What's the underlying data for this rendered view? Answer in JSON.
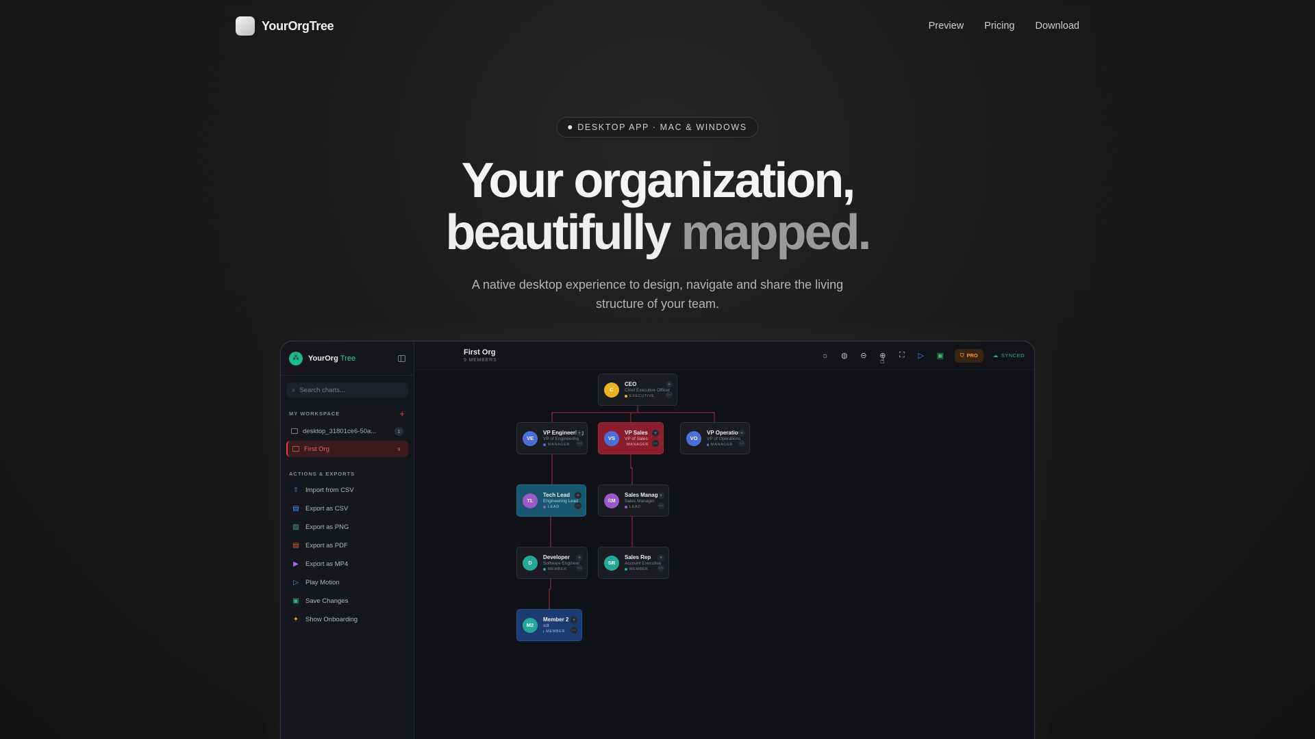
{
  "nav": {
    "brand": "YourOrgTree",
    "links": [
      "Preview",
      "Pricing",
      "Download"
    ]
  },
  "hero": {
    "pill": "DESKTOP APP · MAC & WINDOWS",
    "title_line1": "Your organization,",
    "title_line2a": "beautifully",
    "title_line2b": "mapped.",
    "subtitle": "A native desktop experience to design, navigate and share the living structure of your team."
  },
  "app": {
    "sidebar": {
      "brand_main": "YourOrg",
      "brand_accent": "Tree",
      "search_placeholder": "Search charts...",
      "workspace_label": "MY WORKSPACE",
      "charts": [
        {
          "label": "desktop_31801ce6-50a...",
          "count": "1"
        },
        {
          "label": "First Org",
          "count": "9"
        }
      ],
      "actions_label": "ACTIONS & EXPORTS",
      "actions": [
        {
          "label": "Import from CSV",
          "icon": "upload-icon",
          "color": "#4f8de8"
        },
        {
          "label": "Export as CSV",
          "icon": "file-csv-icon",
          "color": "#4f8de8"
        },
        {
          "label": "Export as PNG",
          "icon": "image-icon",
          "color": "#3bb273"
        },
        {
          "label": "Export as PDF",
          "icon": "file-pdf-icon",
          "color": "#e8553f"
        },
        {
          "label": "Export as MP4",
          "icon": "video-icon",
          "color": "#a86ae8"
        },
        {
          "label": "Play Motion",
          "icon": "play-icon",
          "color": "#4f8de8"
        },
        {
          "label": "Save Changes",
          "icon": "save-icon",
          "color": "#3bb273"
        },
        {
          "label": "Show Onboarding",
          "icon": "sparkle-icon",
          "color": "#e89a3f"
        }
      ]
    },
    "toolbar": {
      "title": "First Org",
      "subtitle": "9 MEMBERS",
      "pro_label": "PRO",
      "sync_label": "SYNCED"
    },
    "nodes": [
      {
        "initials": "C",
        "name": "CEO",
        "role": "Chief Executive Officer",
        "tag": "EXECUTIVE",
        "avatar": "#e8b421",
        "tagdot": "#e8b421"
      },
      {
        "initials": "VE",
        "name": "VP Engineering",
        "role": "VP of Engineering",
        "tag": "MANAGER",
        "avatar": "#4a6fd8",
        "tagdot": "#4a6fd8"
      },
      {
        "initials": "VS",
        "name": "VP Sales",
        "role": "VP of Sales",
        "tag": "MANAGER",
        "avatar": "#4a6fd8",
        "tagdot": "#4a6fd8"
      },
      {
        "initials": "VO",
        "name": "VP Operations",
        "role": "VP of Operations",
        "tag": "MANAGER",
        "avatar": "#4a6fd8",
        "tagdot": "#4a6fd8"
      },
      {
        "initials": "TL",
        "name": "Tech Lead",
        "role": "Engineering Lead",
        "tag": "LEAD",
        "avatar": "#9b59c9",
        "tagdot": "#9b59c9"
      },
      {
        "initials": "SM",
        "name": "Sales Manager",
        "role": "Sales Manager",
        "tag": "LEAD",
        "avatar": "#9b59c9",
        "tagdot": "#9b59c9"
      },
      {
        "initials": "D",
        "name": "Developer",
        "role": "Software Engineer",
        "tag": "MEMBER",
        "avatar": "#25a89a",
        "tagdot": "#25a89a"
      },
      {
        "initials": "SR",
        "name": "Sales Rep",
        "role": "Account Executive",
        "tag": "MEMBER",
        "avatar": "#25a89a",
        "tagdot": "#25a89a"
      },
      {
        "initials": "M2",
        "name": "Member 2",
        "role": "sdt",
        "tag": "MEMBER",
        "avatar": "#25a89a",
        "tagdot": "#25a89a"
      }
    ]
  }
}
